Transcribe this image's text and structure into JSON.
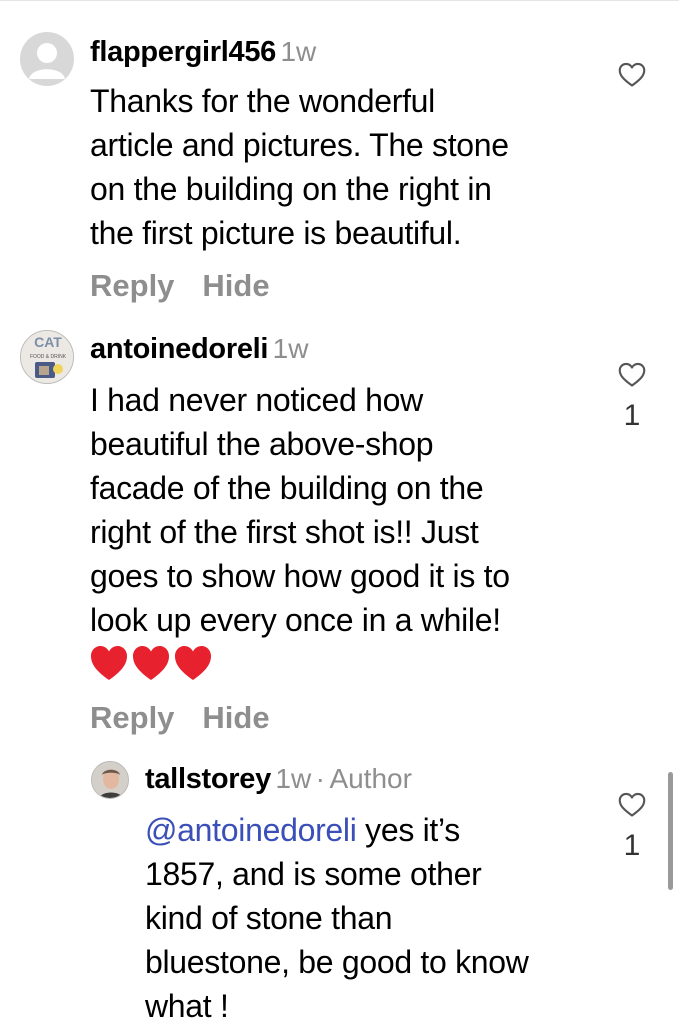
{
  "comments": [
    {
      "username": "flappergirl456",
      "time": "1w",
      "lines": [
        "Thanks for the wonderful",
        "article and pictures. The stone",
        "on the building on the right in",
        "the first picture is beautiful."
      ],
      "like_count": "",
      "reply_label": "Reply",
      "hide_label": "Hide"
    },
    {
      "username": "antoinedoreli",
      "time": "1w",
      "avatar_text": [
        "CAT",
        "FOOD & DRINK"
      ],
      "lines": [
        "I had never noticed how",
        "beautiful the above-shop",
        "facade of the building on the",
        "right of the first shot is!! Just",
        "goes to show how good it is to",
        "look up every once in a while!"
      ],
      "emoji": "❤️❤️❤️",
      "like_count": "1",
      "reply_label": "Reply",
      "hide_label": "Hide"
    },
    {
      "username": "tallstorey",
      "time": "1w",
      "separator": "·",
      "author_badge": "Author",
      "mention": "@antoinedoreli",
      "first_line_rest": " yes it’s",
      "lines": [
        "1857, and is some other",
        "kind of stone than",
        "bluestone, be good to know",
        "what !"
      ],
      "like_count": "1"
    }
  ],
  "colors": {
    "mention": "#3b4fb8",
    "muted": "#8e8e8e",
    "heart": "#e8212e"
  },
  "icons": {
    "like": "heart-outline-icon",
    "emoji": "red-heart-icon"
  }
}
